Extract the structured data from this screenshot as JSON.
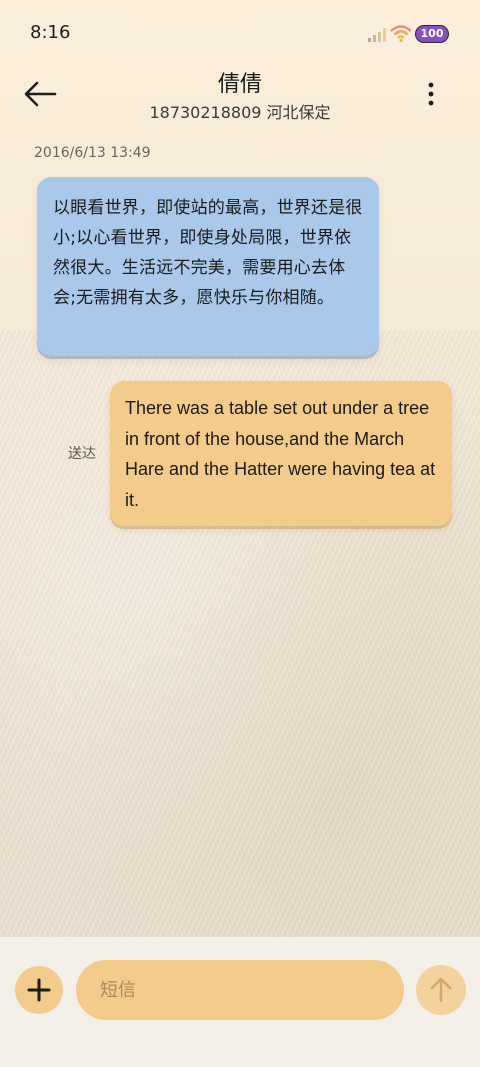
{
  "status_bar": {
    "time": "8:16",
    "battery_level": "100",
    "icons": [
      "signal-icon",
      "wifi-icon",
      "battery-icon"
    ]
  },
  "header": {
    "contact_name": "倩倩",
    "contact_subtitle": "18730218809 河北保定",
    "icons": [
      "back-arrow-icon",
      "more-vertical-icon"
    ]
  },
  "conversation": {
    "timestamp": "2016/6/13 13:49",
    "messages": [
      {
        "direction": "incoming",
        "text": "以眼看世界，即使站的最高，世界还是很小;以心看世界，即使身处局限，世界依然很大。生活远不完美，需要用心去体会;无需拥有太多，愿快乐与你相随。"
      },
      {
        "direction": "outgoing",
        "status": "送达",
        "text": "There was a table set out under a tree in front of the house,and the March Hare and the Hatter were having tea at it."
      }
    ]
  },
  "composer": {
    "placeholder": "短信",
    "value": "",
    "icons": [
      "plus-icon",
      "send-arrow-icon"
    ]
  },
  "colors": {
    "incoming_bubble": "#a9c8ea",
    "outgoing_bubble": "#f3cb8a",
    "background_top": "#fbefdc",
    "battery_badge": "#8a4ec0"
  }
}
